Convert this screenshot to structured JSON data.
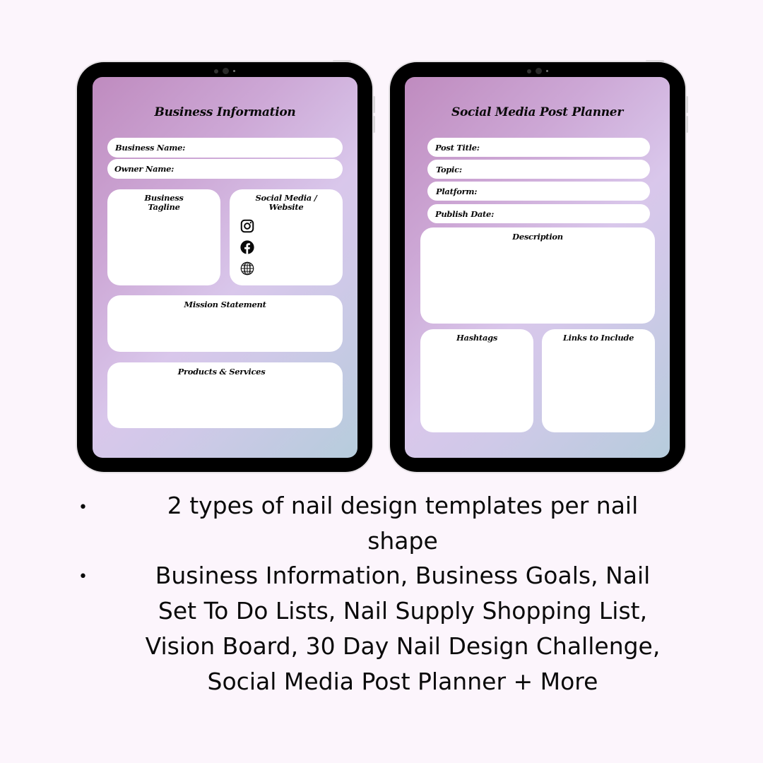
{
  "colors": {
    "page_background": "#FCF5FC",
    "tablet_frame": "#000000",
    "screen_gradient": [
      "#BF8BBF",
      "#D9C7EB",
      "#B6CCDC"
    ],
    "card": "#FFFFFF",
    "text": "#0A0A0A"
  },
  "left_tablet": {
    "title": "Business Information",
    "fields": [
      {
        "label": "Business Name:"
      },
      {
        "label": "Owner Name:"
      }
    ],
    "boxes": {
      "tagline": "Business\nTagline",
      "social": "Social Media /\nWebsite",
      "mission": "Mission Statement",
      "products": "Products & Services"
    },
    "social_icons": [
      "instagram-icon",
      "facebook-icon",
      "globe-icon"
    ]
  },
  "right_tablet": {
    "title": "Social Media Post Planner",
    "fields": [
      {
        "label": "Post Title:"
      },
      {
        "label": "Topic:"
      },
      {
        "label": "Platform:"
      },
      {
        "label": "Publish Date:"
      }
    ],
    "boxes": {
      "description": "Description",
      "hashtags": "Hashtags",
      "links": "Links to Include"
    }
  },
  "features": [
    {
      "lines": [
        "2 types of nail design templates per nail",
        "shape"
      ]
    },
    {
      "lines": [
        "Business Information, Business Goals, Nail",
        "Set To Do Lists, Nail Supply Shopping List,",
        "Vision Board, 30 Day Nail Design Challenge,",
        "Social Media Post Planner + More"
      ]
    }
  ]
}
